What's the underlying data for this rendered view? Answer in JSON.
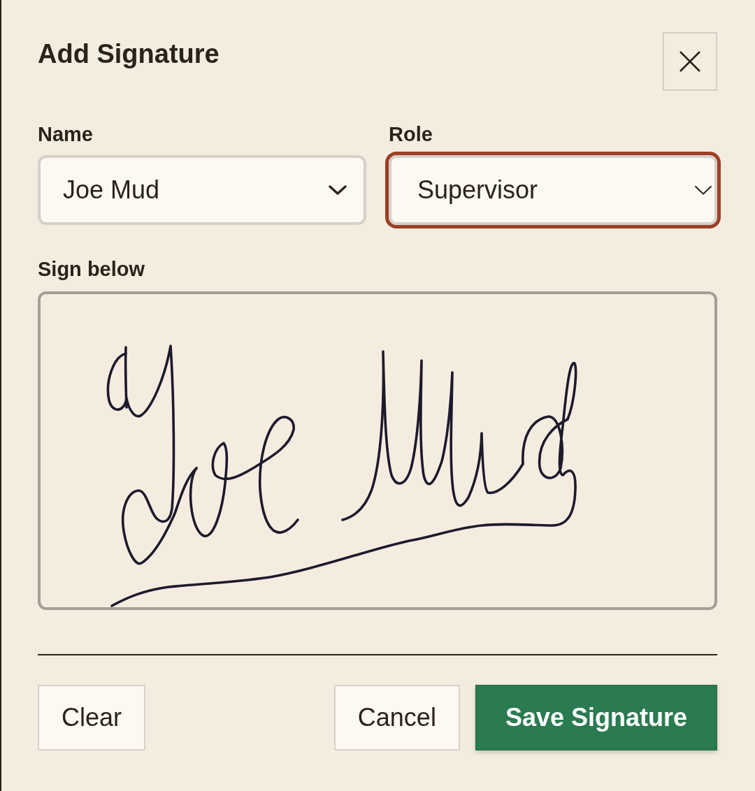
{
  "dialog": {
    "title": "Add Signature"
  },
  "fields": [
    {
      "kind": "combobox",
      "label": "Name",
      "value": "Joe Mud",
      "focused": false
    },
    {
      "kind": "select",
      "label": "Role",
      "value": "Supervisor",
      "focused": true
    }
  ],
  "signature_pad": {
    "label": "Sign below"
  },
  "footer": {
    "left": [
      {
        "kind": "secondary",
        "label": "Clear"
      }
    ],
    "right": [
      {
        "kind": "secondary",
        "label": "Cancel"
      },
      {
        "kind": "primary",
        "label": "Save Signature"
      }
    ]
  }
}
